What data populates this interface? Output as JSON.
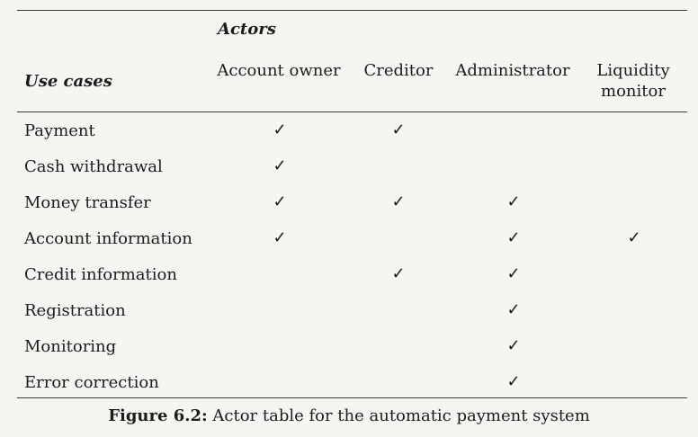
{
  "table": {
    "actors_heading": "Actors",
    "use_cases_heading": "Use cases",
    "actors": [
      {
        "lines": [
          "Account owner"
        ]
      },
      {
        "lines": [
          "Creditor"
        ]
      },
      {
        "lines": [
          "Administrator"
        ]
      },
      {
        "lines": [
          "Liquidity",
          "monitor"
        ]
      }
    ],
    "check_symbol": "✓",
    "rows": [
      {
        "label": "Payment",
        "checks": [
          true,
          true,
          false,
          false
        ]
      },
      {
        "label": "Cash withdrawal",
        "checks": [
          true,
          false,
          false,
          false
        ]
      },
      {
        "label": "Money transfer",
        "checks": [
          true,
          true,
          true,
          false
        ]
      },
      {
        "label": "Account information",
        "checks": [
          true,
          false,
          true,
          true
        ]
      },
      {
        "label": "Credit information",
        "checks": [
          false,
          true,
          true,
          false
        ]
      },
      {
        "label": "Registration",
        "checks": [
          false,
          false,
          true,
          false
        ]
      },
      {
        "label": "Monitoring",
        "checks": [
          false,
          false,
          true,
          false
        ]
      },
      {
        "label": "Error correction",
        "checks": [
          false,
          false,
          true,
          false
        ]
      }
    ]
  },
  "caption": {
    "label": "Figure 6.2:",
    "text": " Actor table for the automatic payment system"
  }
}
